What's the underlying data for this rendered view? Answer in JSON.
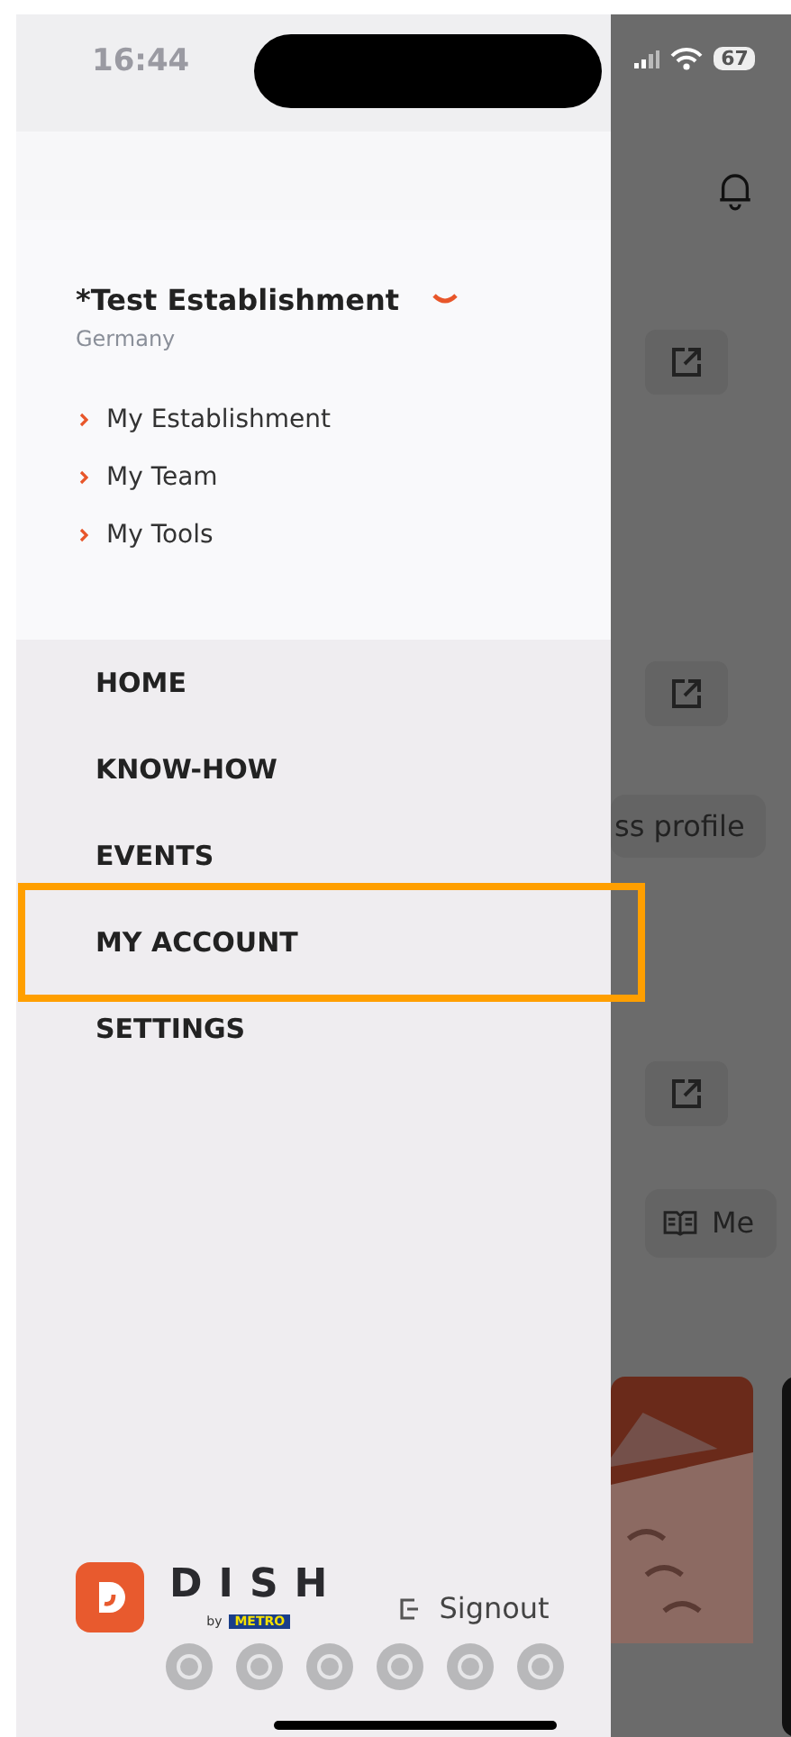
{
  "status_bar": {
    "time": "16:44",
    "battery": "67"
  },
  "drawer": {
    "establishment": {
      "name": "*Test Establishment",
      "country": "Germany",
      "expanded": true
    },
    "links": [
      "My Establishment",
      "My Team",
      "My Tools"
    ],
    "menu": [
      {
        "label": "HOME",
        "highlighted": false
      },
      {
        "label": "KNOW-HOW",
        "highlighted": false
      },
      {
        "label": "EVENTS",
        "highlighted": false
      },
      {
        "label": "MY ACCOUNT",
        "highlighted": true
      },
      {
        "label": "SETTINGS",
        "highlighted": false
      }
    ],
    "logo": {
      "name": "DISH",
      "by": "by",
      "partner": "METRO"
    },
    "signout": "Signout"
  },
  "background": {
    "profile_button": "ss profile",
    "menu_button": "Me"
  }
}
